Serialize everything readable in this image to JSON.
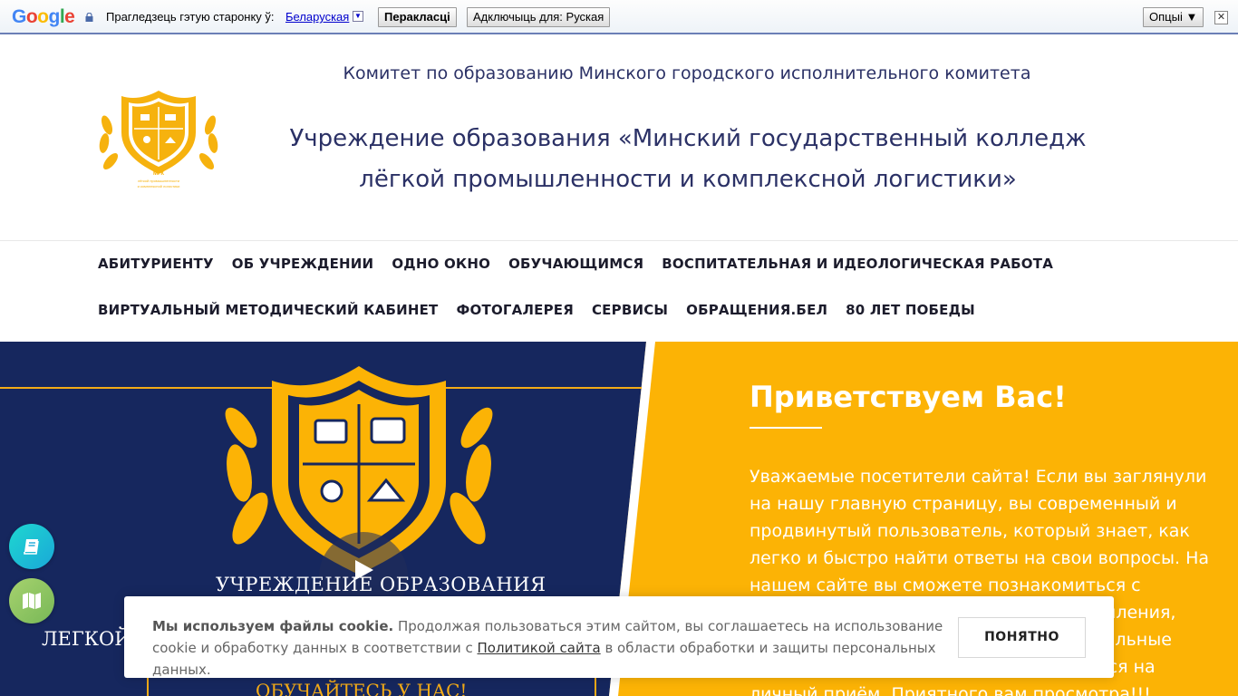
{
  "translate_bar": {
    "logo_letters": [
      "G",
      "o",
      "o",
      "g",
      "l",
      "e"
    ],
    "prompt": "Прагледзець гэтую старонку ў:",
    "language": "Беларуская",
    "arrow": "▼",
    "translate_button": "Перакласці",
    "disable_button": "Адключыць для: Руская",
    "options_button": "Опцыі ▼",
    "close": "✕"
  },
  "header": {
    "committee": "Комитет по образованию Минского городского исполнительного комитета",
    "title": "Учреждение образования «Минский государственный колледж лёгкой промышленности и комплексной логистики»"
  },
  "nav": {
    "row1": [
      "АБИТУРИЕНТУ",
      "ОБ УЧРЕЖДЕНИИ",
      "ОДНО ОКНО",
      "ОБУЧАЮЩИМСЯ",
      "ВОСПИТАТЕЛЬНАЯ И ИДЕОЛОГИЧЕСКАЯ РАБОТА"
    ],
    "row2": [
      "ВИРТУАЛЬНЫЙ МЕТОДИЧЕСКИЙ КАБИНЕТ",
      "ФОТОГАЛЕРЕЯ",
      "СЕРВИСЫ",
      "ОБРАЩЕНИЯ.БЕЛ",
      "80 ЛЕТ ПОБЕДЫ"
    ]
  },
  "hero": {
    "caption1": "УЧРЕЖДЕНИЕ ОБРАЗОВАНИЯ",
    "caption2": "ЛЕГКОЙ",
    "caption3": "ОБУЧАЙТЕСЬ У НАС!",
    "welcome_title": "Приветствуем Вас!",
    "welcome_text": "Уважаемые посетители сайта! Если вы заглянули на нашу главную страницу, вы современный и продвинутый пользователь, который знает, как легко и быстро найти ответы на свои вопросы. На нашем сайте вы сможете познакомиться с условиями обучения, правилами поступления, узнать последние новости, найти актуальные документы, а также сможете записаться на личный приём. Приятного вам просмотра!!!"
  },
  "cookie": {
    "bold": "Мы используем файлы cookie.",
    "text1": " Продолжая пользоваться этим сайтом, вы соглашаетесь на использование cookie и обработку данных в соответствии с ",
    "link": "Политикой сайта",
    "text2": " в области обработки и защиты персональных данных.",
    "button": "ПОНЯТНО"
  },
  "colors": {
    "navy": "#16275e",
    "gold": "#fcb305",
    "title_text": "#2b3166"
  },
  "icons": {
    "fab_top": "book-icon",
    "fab_bottom": "map-icon"
  }
}
